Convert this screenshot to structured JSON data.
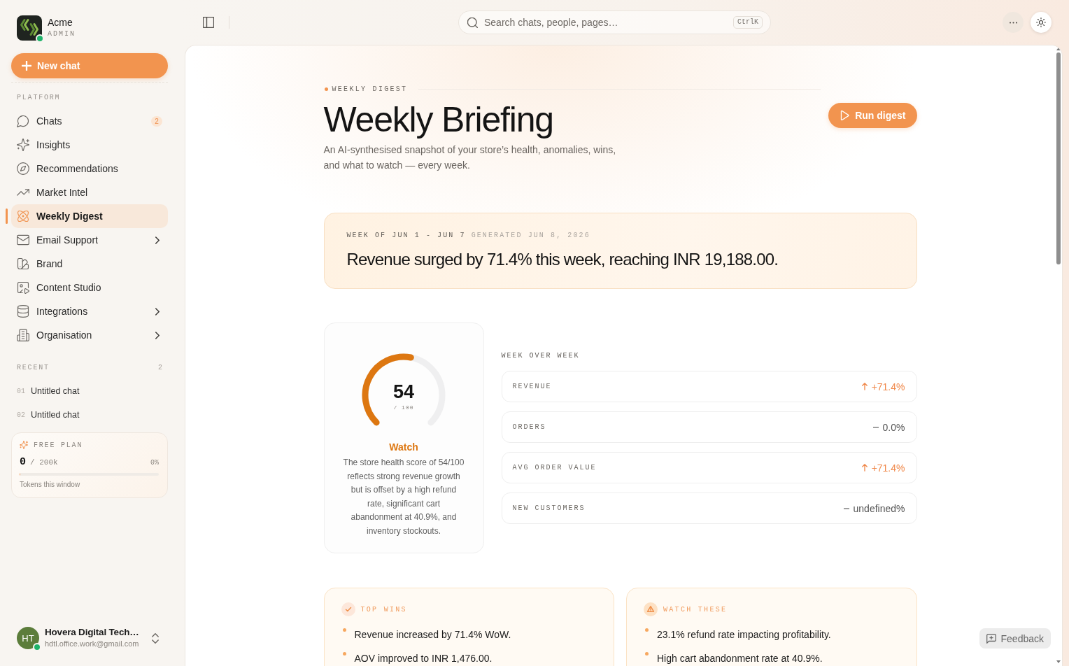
{
  "sidebar": {
    "brand": {
      "name": "Acme",
      "role": "ADMIN",
      "online": true
    },
    "new_chat_button": {
      "label": "New chat"
    },
    "nav": {
      "title": "PLATFORM",
      "items": [
        {
          "label": "Chats",
          "badge": "2",
          "selected": false,
          "submenu": false
        },
        {
          "label": "Insights",
          "selected": false,
          "submenu": false
        },
        {
          "label": "Recommendations",
          "selected": false,
          "submenu": false
        },
        {
          "label": "Market Intel",
          "selected": false,
          "submenu": false
        },
        {
          "label": "Weekly Digest",
          "selected": true,
          "submenu": false
        },
        {
          "label": "Email Support",
          "selected": false,
          "submenu": true
        },
        {
          "label": "Brand",
          "selected": false,
          "submenu": false
        },
        {
          "label": "Content Studio",
          "selected": false,
          "submenu": false
        },
        {
          "label": "Integrations",
          "selected": false,
          "submenu": true
        },
        {
          "label": "Organisation",
          "selected": false,
          "submenu": true
        }
      ]
    },
    "recent": {
      "title": "RECENT",
      "count": "2",
      "items": [
        {
          "number": "01",
          "title": "Untitled chat"
        },
        {
          "number": "02",
          "title": "Untitled chat"
        }
      ]
    },
    "plan": {
      "title": "FREE PLAN",
      "used": "0",
      "limit": "/ 200k",
      "percent": "0%",
      "level": 0,
      "caption": "Tokens this window"
    },
    "user": {
      "initials": "HT",
      "name": "Hovera Digital Tech…",
      "email": "hdtl.office.work@gmail.com",
      "online": true
    }
  },
  "top_bar": {
    "search": {
      "placeholder": "Search chats, people, pages…",
      "shortcut": "CtrlK"
    }
  },
  "header": {
    "eyebrow": "WEEKLY DIGEST",
    "title": "Weekly Briefing",
    "description": "An AI-synthesised snapshot of your store’s health, anomalies, wins, and what to watch — every week.",
    "run_button": {
      "label": "Run digest"
    }
  },
  "summary": {
    "week": "WEEK OF JUN 1 - JUN 7",
    "generated": "GENERATED JUN 8, 2026",
    "headline": "Revenue surged by 71.4% this week, reaching INR 19,188.00."
  },
  "health": {
    "level": 0.54,
    "score": "54",
    "scale": "/ 100",
    "status": "Watch",
    "summary": "The store health score of 54/100 reflects strong revenue growth but is offset by a high refund rate, significant cart abandonment at 40.9%, and inventory stockouts."
  },
  "week_over_week": {
    "title": "WEEK OVER WEEK",
    "metrics": [
      {
        "name": "REVENUE",
        "change": "+71.4%",
        "kind": "increase"
      },
      {
        "name": "ORDERS",
        "change": "0.0%",
        "kind": "flat"
      },
      {
        "name": "AVG ORDER VALUE",
        "change": "+71.4%",
        "kind": "increase"
      },
      {
        "name": "NEW CUSTOMERS",
        "change": "undefined%",
        "kind": "flat"
      }
    ]
  },
  "highlights": [
    {
      "kind": "wins",
      "title": "TOP WINS",
      "items": [
        "Revenue increased by 71.4% WoW.",
        "AOV improved to INR 1,476.00."
      ]
    },
    {
      "kind": "watch",
      "title": "WATCH THESE",
      "items": [
        "23.1% refund rate impacting profitability.",
        "High cart abandonment rate at 40.9%."
      ]
    }
  ],
  "feedback_button": {
    "label": "Feedback"
  }
}
